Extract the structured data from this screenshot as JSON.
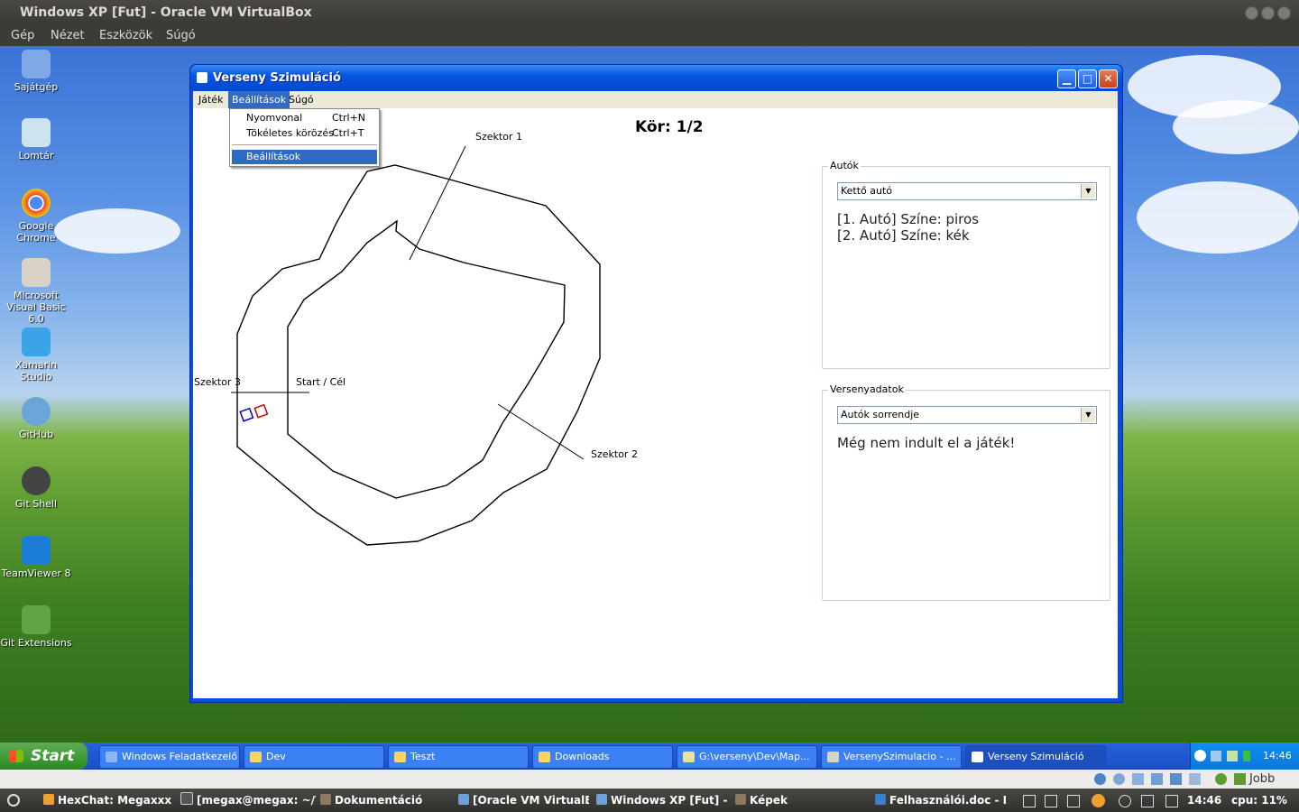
{
  "host_window": {
    "title": "Windows XP [Fut] - Oracle VM VirtualBox",
    "menu": [
      "Gép",
      "Nézet",
      "Eszközök",
      "Súgó"
    ]
  },
  "desktop_icons": [
    {
      "label": "Sajátgép",
      "icon": "computer-icon",
      "color": "#7fa9e6"
    },
    {
      "label": "Lomtár",
      "icon": "recycle-bin-icon",
      "color": "#cfe3ef"
    },
    {
      "label": "Google Chrome",
      "icon": "chrome-icon",
      "color": "#e9463b"
    },
    {
      "label": "Microsoft Visual Basic 6.0",
      "icon": "visual-basic-icon",
      "color": "#d9d2c6"
    },
    {
      "label": "Xamarin Studio",
      "icon": "xamarin-icon",
      "color": "#3aa4e8"
    },
    {
      "label": "GitHub",
      "icon": "github-icon",
      "color": "#6aa7d8"
    },
    {
      "label": "Git Shell",
      "icon": "git-shell-icon",
      "color": "#444444"
    },
    {
      "label": "TeamViewer 8",
      "icon": "teamviewer-icon",
      "color": "#1b7dd6"
    },
    {
      "label": "Git Extensions",
      "icon": "git-extensions-icon",
      "color": "#5fa547"
    }
  ],
  "app": {
    "title": "Verseny Szimuláció",
    "menu": [
      "Játék",
      "Beállítások",
      "Súgó"
    ],
    "dropdown": [
      {
        "label": "Nyomvonal",
        "shortcut": "Ctrl+N"
      },
      {
        "label": "Tökéletes körözés",
        "shortcut": "Ctrl+T"
      },
      {
        "label": "Beállítások",
        "shortcut": ""
      }
    ],
    "lap_text": "Kör: 1/2",
    "track_labels": {
      "sector1": "Szektor 1",
      "sector2": "Szektor 2",
      "sector3": "Szektor 3",
      "start": "Start / Cél"
    },
    "cars_group": {
      "legend": "Autók",
      "select_value": "Kettő autó",
      "lines": [
        "[1. Autó] Színe: piros",
        "[2. Autó] Színe: kék"
      ]
    },
    "race_group": {
      "legend": "Versenyadatok",
      "select_value": "Autók sorrendje",
      "message": "Még nem indult el a játék!"
    }
  },
  "xp_taskbar": {
    "start_label": "Start",
    "tasks": [
      "Windows Feladatkezelő",
      "Dev",
      "Teszt",
      "Downloads",
      "G:\\verseny\\Dev\\Map...",
      "VersenySzimulacio - ...",
      "Verseny Szimuláció"
    ],
    "clock": "14:46"
  },
  "vbox_status": {
    "host_key": "Jobb Ctrl"
  },
  "ubuntu_panel": {
    "tasks": [
      "HexChat: Megaxxx ...",
      "[megax@megax: ~/V...",
      "Dokumentáció",
      "[Oracle VM VirtualB...",
      "Windows XP [Fut] - ...",
      "Képek",
      "Felhasználói.doc - Li..."
    ],
    "clock": "14:46",
    "cpu": "cpu: 11%"
  }
}
